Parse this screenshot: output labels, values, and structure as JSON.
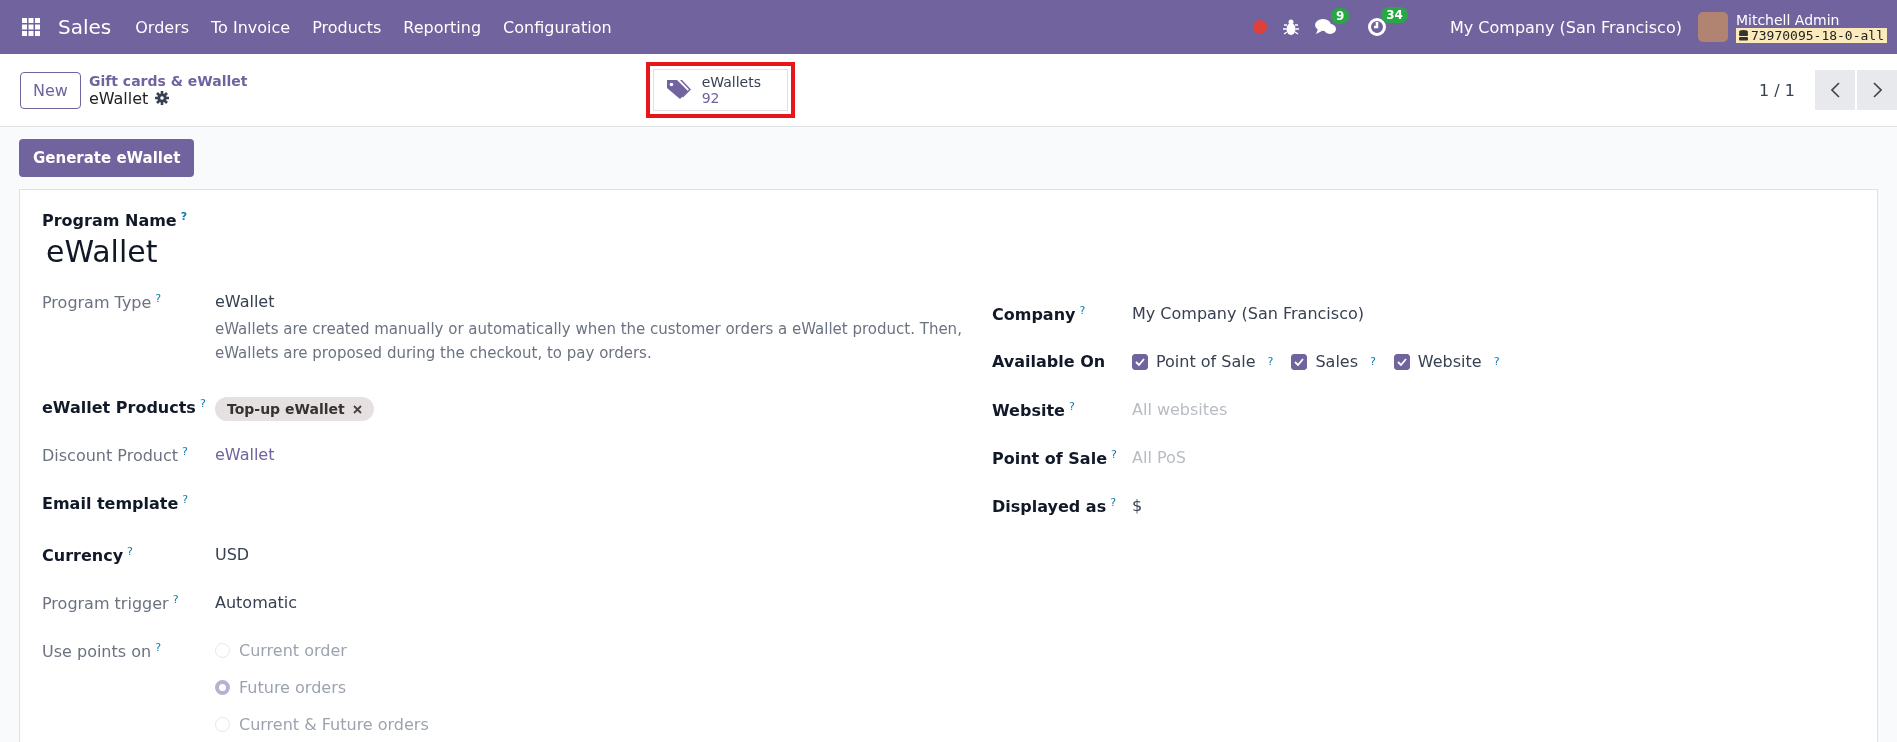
{
  "navbar": {
    "app_name": "Sales",
    "menu": [
      "Orders",
      "To Invoice",
      "Products",
      "Reporting",
      "Configuration"
    ],
    "messages_count": "9",
    "activities_count": "34",
    "company": "My Company (San Francisco)",
    "user": "Mitchell Admin",
    "database": "73970095-18-0-all"
  },
  "breadcrumb": {
    "parent": "Gift cards & eWallet",
    "current": "eWallet"
  },
  "new_button": "New",
  "stat_button": {
    "label": "eWallets",
    "value": "92",
    "highlighted": true
  },
  "pager": "1 / 1",
  "action_button": "Generate eWallet",
  "form": {
    "name_label": "Program Name",
    "name_help": "?",
    "name": "eWallet",
    "left_fields": [
      {
        "label": "Program Type",
        "bold": false,
        "help": "?",
        "kind": "text",
        "value": "eWallet",
        "description": "eWallets are created manually or automatically when the customer orders a eWallet product. Then, eWallets are proposed during the checkout, to pay orders."
      },
      {
        "label": "eWallet Products",
        "bold": true,
        "help": "?",
        "kind": "tag",
        "value": "Top-up eWallet"
      },
      {
        "label": "Discount Product",
        "bold": false,
        "help": "?",
        "kind": "link",
        "value": "eWallet"
      },
      {
        "label": "Email template",
        "bold": true,
        "help": "?",
        "kind": "empty"
      },
      {
        "label": "Currency",
        "bold": true,
        "help": "?",
        "kind": "text",
        "value": "USD"
      },
      {
        "label": "Program trigger",
        "bold": false,
        "help": "?",
        "kind": "text",
        "value": "Automatic"
      },
      {
        "label": "Use points on",
        "bold": false,
        "help": "?",
        "kind": "radio",
        "disabled": true,
        "options": [
          {
            "label": "Current order",
            "selected": false
          },
          {
            "label": "Future orders",
            "selected": true
          },
          {
            "label": "Current & Future orders",
            "selected": false
          }
        ]
      }
    ],
    "right_fields": [
      {
        "label": "Company",
        "bold": true,
        "help": "?",
        "kind": "text",
        "value": "My Company (San Francisco)"
      },
      {
        "label": "Available On",
        "bold": true,
        "kind": "checkboxes",
        "options": [
          {
            "label": "Point of Sale",
            "checked": true,
            "help": "?"
          },
          {
            "label": "Sales",
            "checked": true,
            "help": "?"
          },
          {
            "label": "Website",
            "checked": true,
            "help": "?"
          }
        ]
      },
      {
        "label": "Website",
        "bold": true,
        "help": "?",
        "kind": "placeholder",
        "placeholder": "All websites"
      },
      {
        "label": "Point of Sale",
        "bold": true,
        "help": "?",
        "kind": "placeholder",
        "placeholder": "All PoS"
      },
      {
        "label": "Displayed as",
        "bold": true,
        "help": "?",
        "kind": "text",
        "value": "$"
      }
    ]
  }
}
